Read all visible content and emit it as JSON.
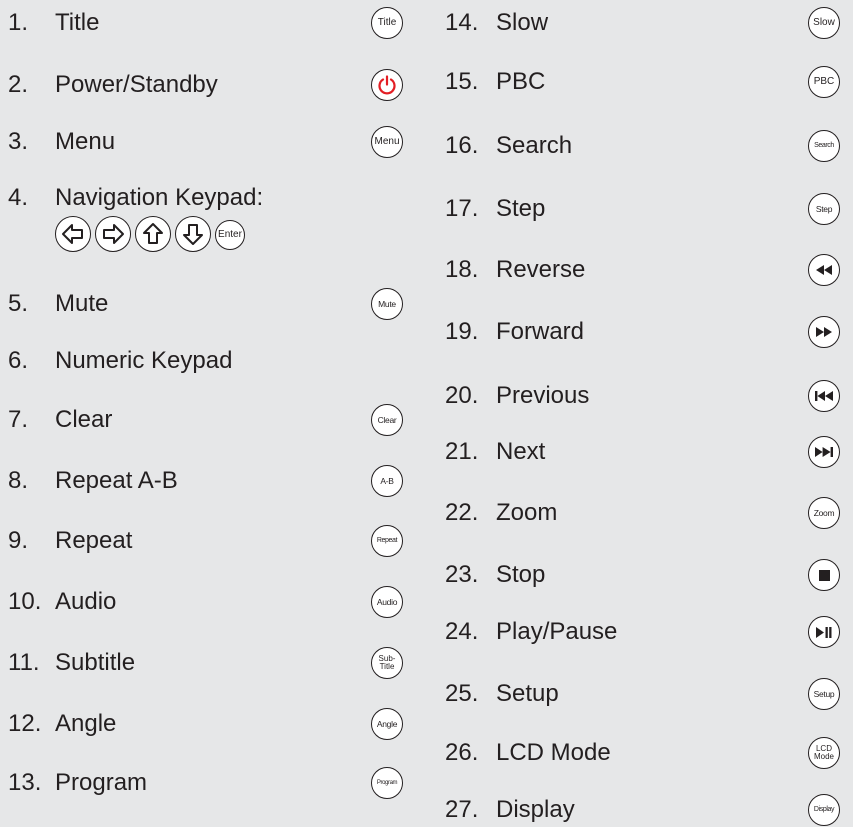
{
  "left": [
    {
      "num": "1.",
      "label": "Title",
      "btn": "Title",
      "icon": "text"
    },
    {
      "num": "2.",
      "label": "Power/Standby",
      "btn": "",
      "icon": "power-icon"
    },
    {
      "num": "3.",
      "label": "Menu",
      "btn": "Menu",
      "icon": "text"
    },
    {
      "num": "4.",
      "label": "Navigation Keypad:",
      "btn": "",
      "icon": "none"
    },
    {
      "num": "5.",
      "label": "Mute",
      "btn": "Mute",
      "icon": "text"
    },
    {
      "num": "6.",
      "label": "Numeric Keypad",
      "btn": "",
      "icon": "none"
    },
    {
      "num": "7.",
      "label": "Clear",
      "btn": "Clear",
      "icon": "text"
    },
    {
      "num": "8.",
      "label": "Repeat A-B",
      "btn": "A-B",
      "icon": "text"
    },
    {
      "num": "9.",
      "label": "Repeat",
      "btn": "Repeat",
      "icon": "text"
    },
    {
      "num": "10.",
      "label": "Audio",
      "btn": "Audio",
      "icon": "text"
    },
    {
      "num": "11.",
      "label": "Subtitle",
      "btn_line1": "Sub-",
      "btn_line2": "Title",
      "icon": "text-2line"
    },
    {
      "num": "12.",
      "label": "Angle",
      "btn": "Angle",
      "icon": "text"
    },
    {
      "num": "13.",
      "label": "Program",
      "btn": "Program",
      "icon": "text"
    }
  ],
  "nav_keys": [
    {
      "icon": "left-arrow-icon"
    },
    {
      "icon": "right-arrow-icon"
    },
    {
      "icon": "up-arrow-icon"
    },
    {
      "icon": "down-arrow-icon"
    },
    {
      "btn": "Enter"
    }
  ],
  "right": [
    {
      "num": "14.",
      "label": "Slow",
      "btn": "Slow",
      "icon": "text"
    },
    {
      "num": "15.",
      "label": "PBC",
      "btn": "PBC",
      "icon": "text"
    },
    {
      "num": "16.",
      "label": "Search",
      "btn": "Search",
      "icon": "text"
    },
    {
      "num": "17.",
      "label": "Step",
      "btn": "Step",
      "icon": "text"
    },
    {
      "num": "18.",
      "label": "Reverse",
      "btn": "",
      "icon": "rewind-icon"
    },
    {
      "num": "19.",
      "label": "Forward",
      "btn": "",
      "icon": "fast-forward-icon"
    },
    {
      "num": "20.",
      "label": "Previous",
      "btn": "",
      "icon": "skip-previous-icon"
    },
    {
      "num": "21.",
      "label": "Next",
      "btn": "",
      "icon": "skip-next-icon"
    },
    {
      "num": "22.",
      "label": "Zoom",
      "btn": "Zoom",
      "icon": "text"
    },
    {
      "num": "23.",
      "label": "Stop",
      "btn": "",
      "icon": "stop-icon"
    },
    {
      "num": "24.",
      "label": "Play/Pause",
      "btn": "",
      "icon": "play-pause-icon"
    },
    {
      "num": "25.",
      "label": "Setup",
      "btn": "Setup",
      "icon": "text"
    },
    {
      "num": "26.",
      "label": "LCD Mode",
      "btn_line1": "LCD",
      "btn_line2": "Mode",
      "icon": "text-2line"
    },
    {
      "num": "27.",
      "label": "Display",
      "btn": "Display",
      "icon": "text"
    }
  ],
  "colors": {
    "background": "#e6e7e8",
    "text": "#231f20",
    "button_fill": "#ffffff",
    "power_accent": "#e31e24"
  }
}
